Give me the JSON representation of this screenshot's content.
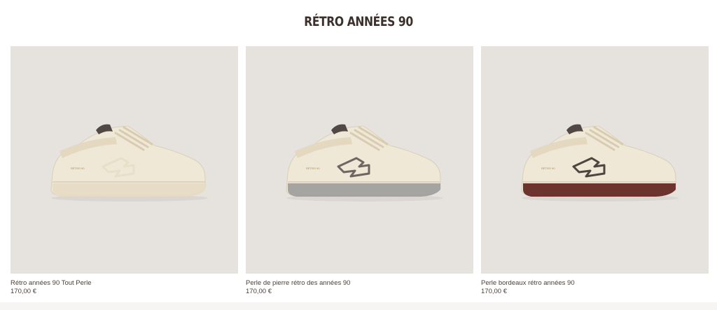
{
  "section": {
    "title": "RÉTRO ANNÉES 90"
  },
  "products": [
    {
      "name": "Rétro années 90 Tout Perle",
      "price": "170,00 €",
      "image": "sneaker-all-pearl-image",
      "sole_color": "#e6dac4",
      "logo_color": "#e8dfc9"
    },
    {
      "name": "Perle de pierre rétro des années 90",
      "price": "170,00 €",
      "image": "sneaker-pearl-stone-image",
      "sole_color": "#9c9c9a",
      "logo_color": "#6d6662"
    },
    {
      "name": "Perle bordeaux rétro années 90",
      "price": "170,00 €",
      "image": "sneaker-pearl-burgundy-image",
      "sole_color": "#5e1f1c",
      "logo_color": "#4e4541"
    }
  ],
  "colors": {
    "image_background": "#e6e3df",
    "sneaker_body": "#efe8d6"
  }
}
